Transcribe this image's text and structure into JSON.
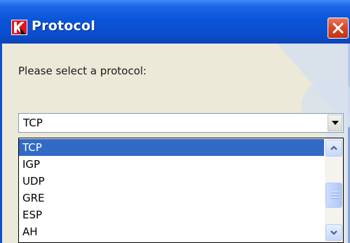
{
  "window": {
    "title": "Protocol",
    "logo_icon": "kaspersky-k-logo",
    "close_icon": "close-x-icon"
  },
  "prompt": "Please select a protocol:",
  "combo": {
    "selected": "TCP",
    "arrow_icon": "chevron-down-icon"
  },
  "dropdown": {
    "options": [
      {
        "label": "TCP",
        "selected": true
      },
      {
        "label": "IGP",
        "selected": false
      },
      {
        "label": "UDP",
        "selected": false
      },
      {
        "label": "GRE",
        "selected": false
      },
      {
        "label": "ESP",
        "selected": false
      },
      {
        "label": "AH",
        "selected": false
      }
    ],
    "scroll_up_icon": "scroll-up-arrow-icon",
    "scroll_down_icon": "scroll-down-arrow-icon"
  },
  "colors": {
    "titlebar": "#0a54d9",
    "selection": "#316ac5",
    "client_bg": "#ece9d8",
    "close_button": "#d9482a",
    "logo_red": "#e3141b"
  }
}
